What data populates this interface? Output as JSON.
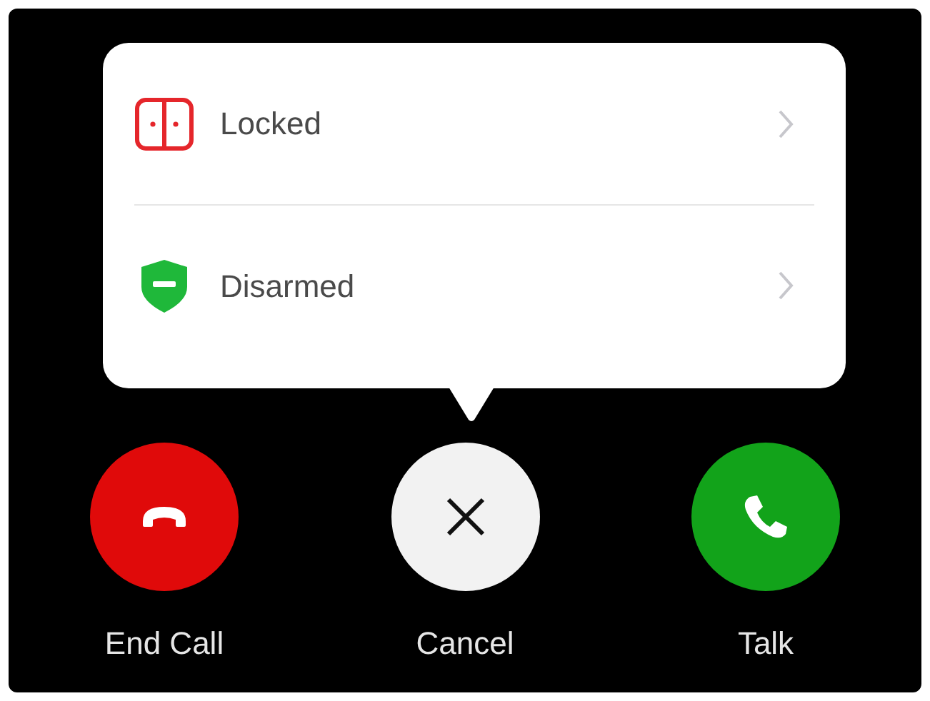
{
  "popover": {
    "items": [
      {
        "kind": "lock",
        "label": "Locked"
      },
      {
        "kind": "shield",
        "label": "Disarmed"
      }
    ]
  },
  "actions": [
    {
      "kind": "end",
      "label": "End Call"
    },
    {
      "kind": "cancel",
      "label": "Cancel"
    },
    {
      "kind": "talk",
      "label": "Talk"
    }
  ]
}
